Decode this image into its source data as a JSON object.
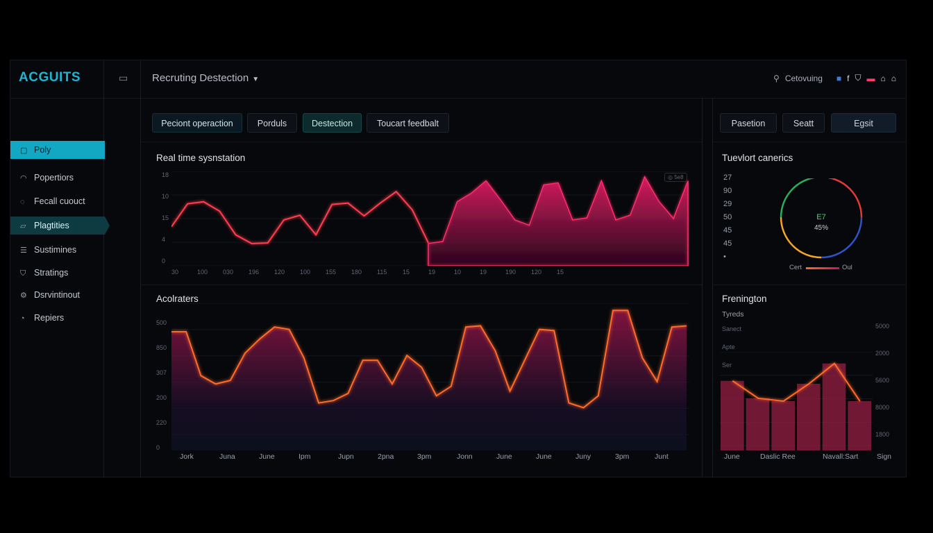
{
  "app": {
    "brand": "ACGUITS",
    "project": "Recruting Destection",
    "user": "Cetovuing"
  },
  "sidebar": {
    "items": [
      {
        "label": "Poly",
        "icon": "briefcase-icon"
      },
      {
        "label": "Popertiors",
        "icon": "bell-icon"
      },
      {
        "label": "Fecall cuouct",
        "icon": "chat-icon"
      },
      {
        "label": "Plagtities",
        "icon": "folder-icon"
      },
      {
        "label": "Sustimines",
        "icon": "list-icon"
      },
      {
        "label": "Stratings",
        "icon": "shield-icon"
      },
      {
        "label": "Dsrvintinout",
        "icon": "gear-icon"
      },
      {
        "label": "Repiers",
        "icon": "chart-icon"
      }
    ]
  },
  "tabs": [
    "Peciont operaction",
    "Porduls",
    "Destection",
    "Toucart feedbalt"
  ],
  "right_buttons": [
    "Pasetion",
    "Seatt",
    "Egsit"
  ],
  "panels": {
    "realtime": {
      "title": "Real time sysnstation",
      "badge": "◎ 5e8"
    },
    "accelerators": {
      "title": "Acolraters"
    },
    "ring": {
      "title": "Tuevlort canerics",
      "center_top": "E7",
      "center_bottom": "45%",
      "legend_left": "Cert",
      "legend_right": "Oul"
    },
    "frenington": {
      "title": "Frenington",
      "subtitle": "Tyreds"
    }
  },
  "chart_data": [
    {
      "type": "line",
      "title": "Real time sysnstation",
      "y_ticks": [
        "18",
        "10",
        "15",
        "4",
        "0"
      ],
      "x_ticks": [
        "30",
        "100",
        "030",
        "196",
        "120",
        "100",
        "155",
        "180",
        "115",
        "15",
        "19",
        "10",
        "19",
        "190",
        "120",
        "15"
      ],
      "line_series": [
        5.8,
        9.2,
        9.5,
        8.1,
        4.6,
        3.3,
        3.4,
        6.8,
        7.5,
        4.6,
        9.1,
        9.3,
        7.4,
        9.3,
        11.0,
        8.3,
        3.4
      ],
      "area_series": [
        3.3,
        3.6,
        9.5,
        10.8,
        12.6,
        9.8,
        6.8,
        6.0,
        12.0,
        12.3,
        6.8,
        7.1,
        12.6,
        6.8,
        7.5,
        13.2,
        9.5,
        7.0,
        12.6
      ]
    },
    {
      "type": "area",
      "title": "Acolraters",
      "y_ticks": [
        "500",
        "850",
        "307",
        "200",
        "220",
        "0"
      ],
      "x_ticks": [
        "Jork",
        "Juna",
        "June",
        "Ipm",
        "Jupn",
        "2pna",
        "3pm",
        "Jonn",
        "June",
        "June",
        "Juny",
        "3pm",
        "Junt"
      ],
      "values": [
        500,
        500,
        315,
        280,
        295,
        410,
        470,
        520,
        510,
        390,
        200,
        210,
        240,
        380,
        380,
        280,
        400,
        350,
        230,
        270,
        520,
        525,
        420,
        250,
        380,
        510,
        505,
        200,
        180,
        230,
        590,
        590,
        390,
        290,
        520,
        525
      ]
    },
    {
      "type": "bar",
      "title": "Frenington",
      "categories": [
        "June",
        "Daslic Ree",
        "Navall:Sart",
        "Sign"
      ],
      "row_labels": [
        "Sanect",
        "Apte",
        "Ser"
      ],
      "y_ticks": [
        "5000",
        "2000",
        "5600",
        "8000",
        "1800"
      ],
      "values": [
        2400,
        1800,
        1700,
        2300,
        3000,
        1700
      ]
    }
  ],
  "colors": {
    "accent": "#12a7c2",
    "line": "#ff3d4f",
    "area": "#c2185b",
    "orange": "#ff6a2b",
    "bg": "#07080b"
  }
}
